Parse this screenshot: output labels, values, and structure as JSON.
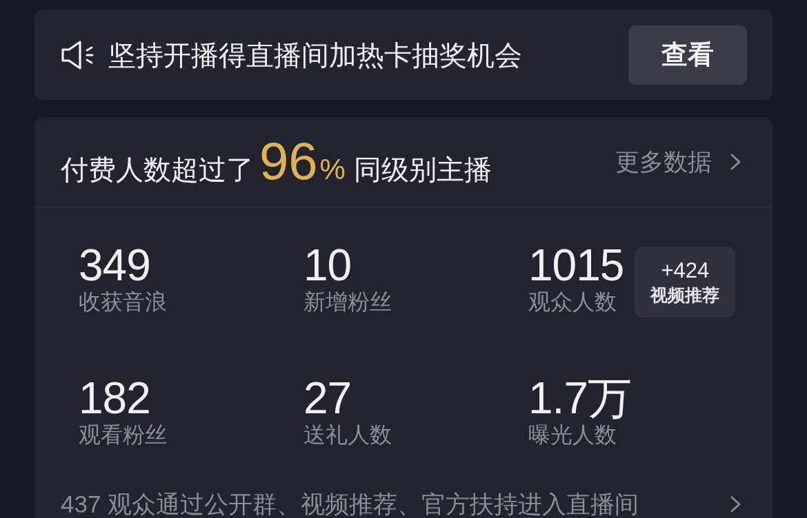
{
  "notice": {
    "text": "坚持开播得直播间加热卡抽奖机会",
    "button": "查看"
  },
  "summary": {
    "headline": {
      "prefix": "付费人数超过了",
      "percent": "96",
      "unit": "%",
      "suffix": "同级别主播"
    },
    "more_link": "更多数据"
  },
  "stats": [
    {
      "value": "349",
      "label": "收获音浪"
    },
    {
      "value": "10",
      "label": "新增粉丝"
    },
    {
      "value": "1015",
      "label": "观众人数",
      "badge": {
        "value": "+424",
        "label": "视频推荐"
      }
    },
    {
      "value": "182",
      "label": "观看粉丝"
    },
    {
      "value": "27",
      "label": "送礼人数"
    },
    {
      "value": "1.7万",
      "label": "曝光人数"
    }
  ],
  "traffic_source": {
    "text": "437 观众通过公开群、视频推荐、官方扶持进入直播间"
  }
}
